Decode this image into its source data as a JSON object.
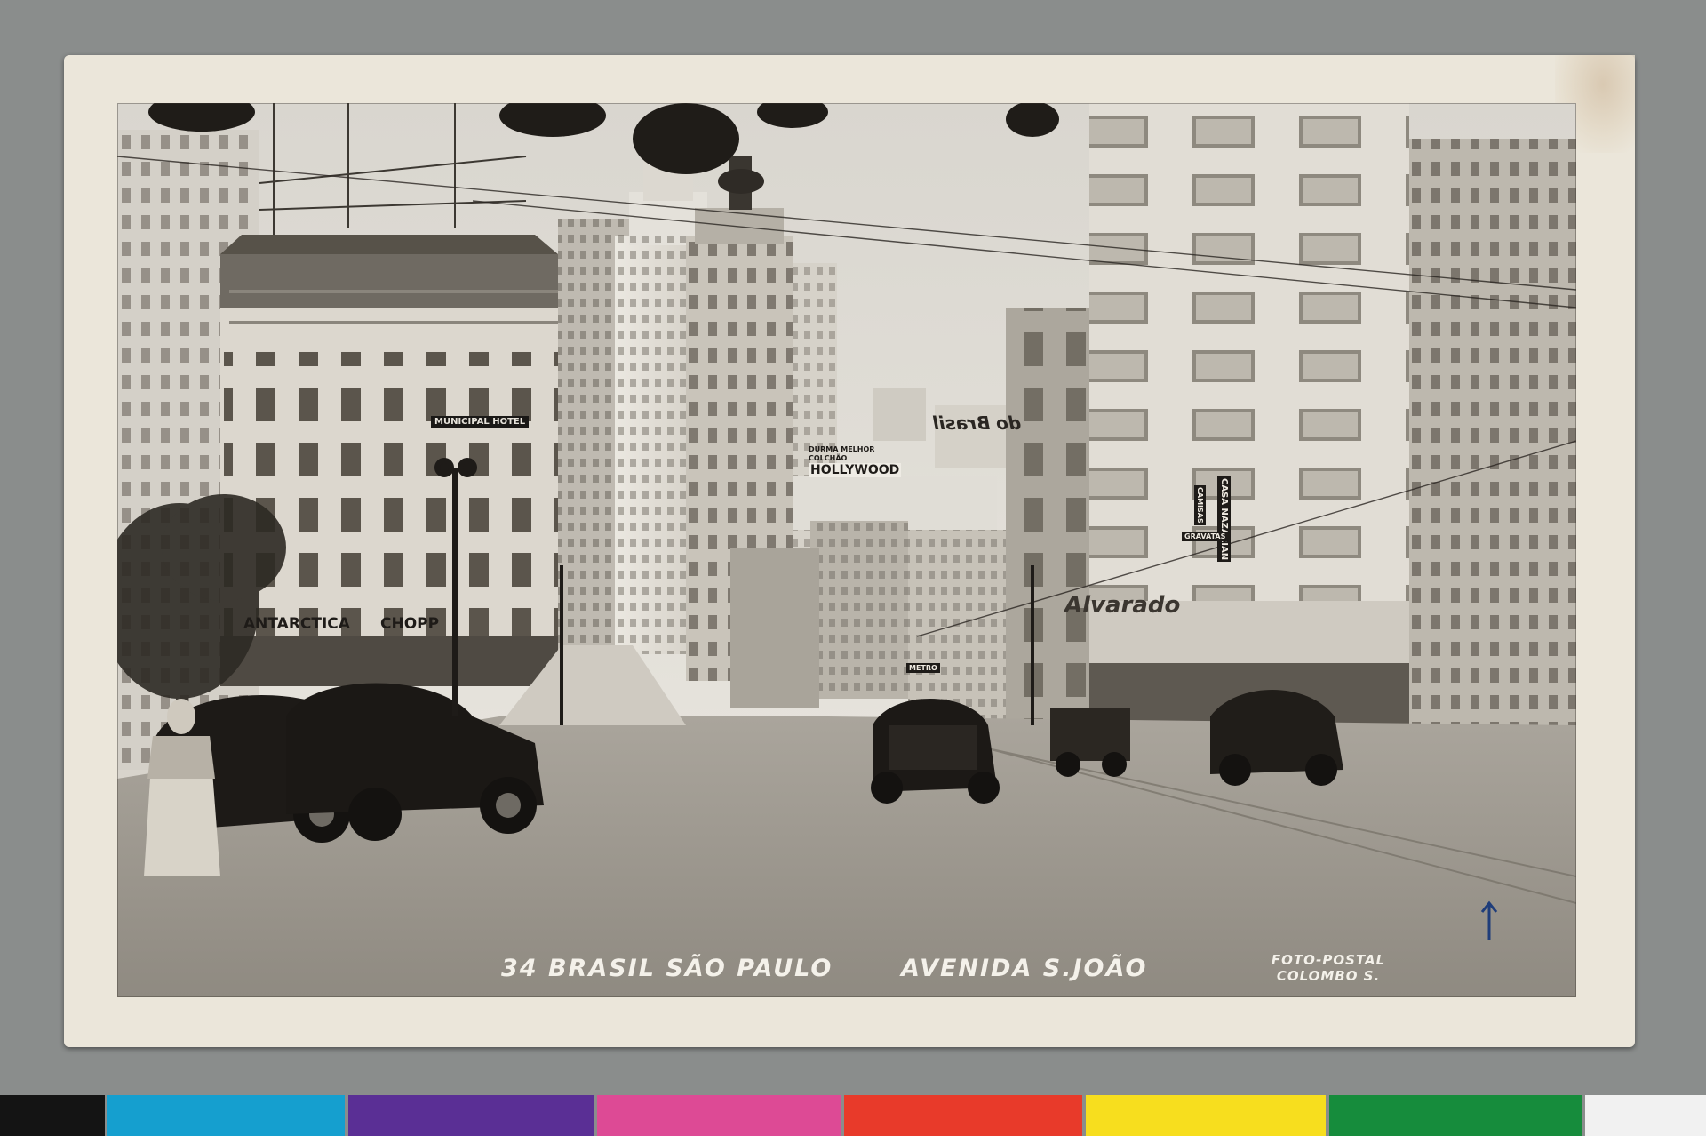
{
  "postcard": {
    "caption_number_city": "34 BRASIL SÃO PAULO",
    "caption_street": "AVENIDA S.JOÃO",
    "credit_line1": "FOTO-POSTAL",
    "credit_line2": "COLOMBO S.",
    "signs": {
      "hotel": "MUNICIPAL HOTEL",
      "antarctica": "ANTARCTICA",
      "chopp": "CHOPP",
      "hollywood": "HOLLYWOOD",
      "durma": "DURMA MELHOR",
      "colchao": "COLCHÃO",
      "casa": "CASA NAZARIAN",
      "camisas": "CAMISAS",
      "gravatas": "GRAVATAS",
      "alvarado": "Alvarado",
      "metro": "METRO",
      "brasil_sign": "do Brasil"
    }
  },
  "color_bar": [
    "#141414",
    "#159fcf",
    "#5a2f95",
    "#dd4a95",
    "#e83a2a",
    "#f7de1e",
    "#168c3c",
    "#f1f1f1"
  ]
}
